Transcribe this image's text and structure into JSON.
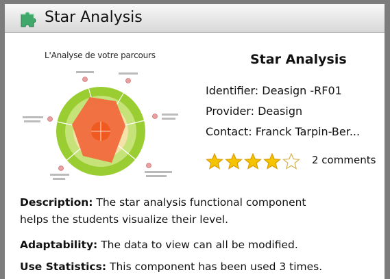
{
  "window": {
    "title": "Star Analysis"
  },
  "thumbnail": {
    "title": "L'Analyse de votre parcours"
  },
  "info": {
    "name": "Star Analysis",
    "identifier": "Identifier: Deasign -RF01",
    "provider": "Provider: Deasign",
    "contact": "Contact: Franck Tarpin-Ber...",
    "rating": 4,
    "rating_max": 5,
    "comments": "2 comments"
  },
  "details": {
    "description_label": "Description:",
    "description_text": " The star analysis functional component",
    "description_text2": "helps the students visualize their level.",
    "adaptability_label": "Adaptability:",
    "adaptability_text": " The data to view can all be modified.",
    "stats_label": "Use Statistics:",
    "stats_text": " This component has been used 3 times."
  },
  "colors": {
    "titlebar": "#dedede",
    "puzzle": "#3fa86a",
    "star_fill": "#f5c400",
    "outer_ring": "#9acd32",
    "inner_fill": "#f4e2a8",
    "polygon": "#f06a3c"
  },
  "icons": {
    "window": "puzzle-piece-icon",
    "rating": "star-icon"
  }
}
